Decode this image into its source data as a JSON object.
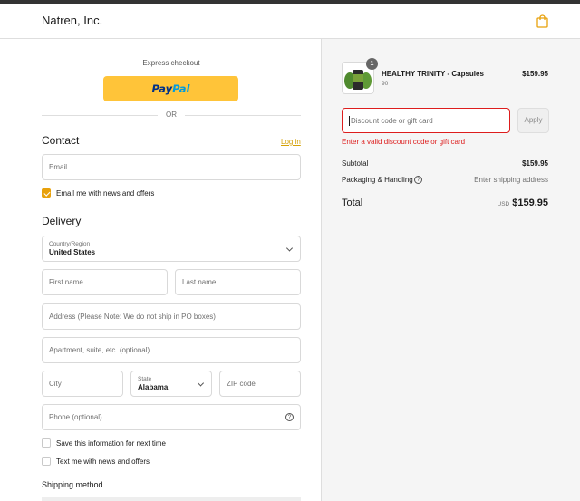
{
  "header": {
    "brand": "Natren, Inc.",
    "bag_icon": "shopping-bag-icon",
    "accent": "#e8a10b"
  },
  "express": {
    "label": "Express checkout",
    "paypal_part1": "Pay",
    "paypal_part2": "Pal",
    "or": "OR"
  },
  "contact": {
    "title": "Contact",
    "login": "Log in",
    "email_placeholder": "Email",
    "newsletter_label": "Email me with news and offers",
    "newsletter_checked": true
  },
  "delivery": {
    "title": "Delivery",
    "country_label": "Country/Region",
    "country_value": "United States",
    "first_name_placeholder": "First name",
    "last_name_placeholder": "Last name",
    "address_placeholder": "Address (Please Note: We do not ship in PO boxes)",
    "apartment_placeholder": "Apartment, suite, etc. (optional)",
    "city_placeholder": "City",
    "state_label": "State",
    "state_value": "Alabama",
    "zip_placeholder": "ZIP code",
    "phone_placeholder": "Phone (optional)",
    "save_info_label": "Save this information for next time",
    "text_me_label": "Text me with news and offers"
  },
  "shipping": {
    "title": "Shipping method"
  },
  "summary": {
    "product_name": "HEALTHY TRINITY - Capsules",
    "product_variant": "90",
    "product_price": "$159.95",
    "quantity": "1",
    "discount_placeholder": "Discount code or gift card",
    "apply_label": "Apply",
    "error_text": "Enter a valid discount code or gift card",
    "subtotal_label": "Subtotal",
    "subtotal_value": "$159.95",
    "packaging_label": "Packaging & Handling",
    "packaging_value": "Enter shipping address",
    "total_label": "Total",
    "currency": "USD",
    "total_value": "$159.95"
  }
}
